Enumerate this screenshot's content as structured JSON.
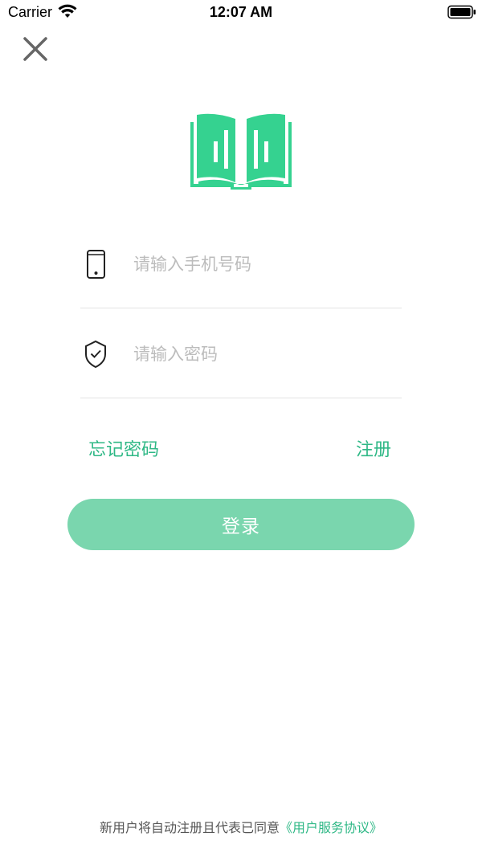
{
  "status_bar": {
    "carrier": "Carrier",
    "time": "12:07 AM"
  },
  "logo": {
    "icon": "open-book-icon",
    "color": "#35d290"
  },
  "form": {
    "phone_placeholder": "请输入手机号码",
    "phone_icon": "phone-icon",
    "password_placeholder": "请输入密码",
    "password_icon": "shield-check-icon"
  },
  "links": {
    "forgot_password": "忘记密码",
    "register": "注册"
  },
  "login_button": {
    "label": "登录"
  },
  "agreement": {
    "prefix": "新用户将自动注册且代表已同意",
    "link": "《用户服务协议》"
  },
  "colors": {
    "accent": "#2fb886",
    "button_bg": "#7ad6ae",
    "placeholder": "#bcbcbc",
    "divider": "#e2e2e2"
  }
}
